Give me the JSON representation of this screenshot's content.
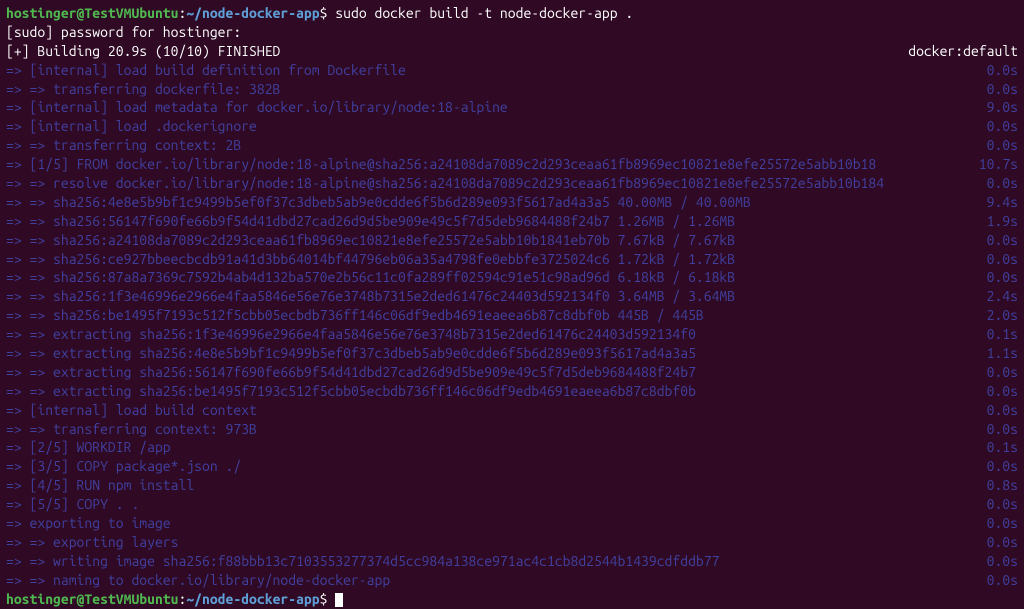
{
  "prompt1": {
    "user": "hostinger@TestVMUbuntu",
    "sep": ":",
    "path": "~/node-docker-app",
    "dollar": "$ ",
    "command": "sudo docker build -t node-docker-app ."
  },
  "sudo_prompt": "[sudo] password for hostinger:",
  "build_status": {
    "left": "[+] Building 20.9s (10/10) FINISHED",
    "right": "docker:default"
  },
  "lines": [
    {
      "text": "=> [internal] load build definition from Dockerfile",
      "time": "0.0s"
    },
    {
      "text": "=> => transferring dockerfile: 382B",
      "time": "0.0s"
    },
    {
      "text": "=> [internal] load metadata for docker.io/library/node:18-alpine",
      "time": "9.0s"
    },
    {
      "text": "=> [internal] load .dockerignore",
      "time": "0.0s"
    },
    {
      "text": "=> => transferring context: 2B",
      "time": "0.0s"
    },
    {
      "text": "=> [1/5] FROM docker.io/library/node:18-alpine@sha256:a24108da7089c2d293ceaa61fb8969ec10821e8efe25572e5abb10b18",
      "time": "10.7s"
    },
    {
      "text": "=> => resolve docker.io/library/node:18-alpine@sha256:a24108da7089c2d293ceaa61fb8969ec10821e8efe25572e5abb10b184",
      "time": "0.0s"
    },
    {
      "text": "=> => sha256:4e8e5b9bf1c9499b5ef0f37c3dbeb5ab9e0cdde6f5b6d289e093f5617ad4a3a5 40.00MB / 40.00MB",
      "time": "9.4s"
    },
    {
      "text": "=> => sha256:56147f690fe66b9f54d41dbd27cad26d9d5be909e49c5f7d5deb9684488f24b7 1.26MB / 1.26MB",
      "time": "1.9s"
    },
    {
      "text": "=> => sha256:a24108da7089c2d293ceaa61fb8969ec10821e8efe25572e5abb10b1841eb70b 7.67kB / 7.67kB",
      "time": "0.0s"
    },
    {
      "text": "=> => sha256:ce927bbeecbcdb91a41d3bb64014bf44796eb06a35a4798fe0ebbfe3725024c6 1.72kB / 1.72kB",
      "time": "0.0s"
    },
    {
      "text": "=> => sha256:87a8a7369c7592b4ab4d132ba570e2b56c11c0fa289ff02594c91e51c98ad96d 6.18kB / 6.18kB",
      "time": "0.0s"
    },
    {
      "text": "=> => sha256:1f3e46996e2966e4faa5846e56e76e3748b7315e2ded61476c24403d592134f0 3.64MB / 3.64MB",
      "time": "2.4s"
    },
    {
      "text": "=> => sha256:be1495f7193c512f5cbb05ecbdb736ff146c06df9edb4691eaeea6b87c8dbf0b 445B / 445B",
      "time": "2.0s"
    },
    {
      "text": "=> => extracting sha256:1f3e46996e2966e4faa5846e56e76e3748b7315e2ded61476c24403d592134f0",
      "time": "0.1s"
    },
    {
      "text": "=> => extracting sha256:4e8e5b9bf1c9499b5ef0f37c3dbeb5ab9e0cdde6f5b6d289e093f5617ad4a3a5",
      "time": "1.1s"
    },
    {
      "text": "=> => extracting sha256:56147f690fe66b9f54d41dbd27cad26d9d5be909e49c5f7d5deb9684488f24b7",
      "time": "0.0s"
    },
    {
      "text": "=> => extracting sha256:be1495f7193c512f5cbb05ecbdb736ff146c06df9edb4691eaeea6b87c8dbf0b",
      "time": "0.0s"
    },
    {
      "text": "=> [internal] load build context",
      "time": "0.0s"
    },
    {
      "text": "=> => transferring context: 973B",
      "time": "0.0s"
    },
    {
      "text": "=> [2/5] WORKDIR /app",
      "time": "0.1s"
    },
    {
      "text": "=> [3/5] COPY package*.json ./",
      "time": "0.0s"
    },
    {
      "text": "=> [4/5] RUN npm install",
      "time": "0.8s"
    },
    {
      "text": "=> [5/5] COPY . .",
      "time": "0.0s"
    },
    {
      "text": "=> exporting to image",
      "time": "0.0s"
    },
    {
      "text": "=> => exporting layers",
      "time": "0.0s"
    },
    {
      "text": "=> => writing image sha256:f88bbb13c7103553277374d5cc984a138ce971ac4c1cb8d2544b1439cdfddb77",
      "time": "0.0s"
    },
    {
      "text": "=> => naming to docker.io/library/node-docker-app",
      "time": "0.0s"
    }
  ],
  "prompt2": {
    "user": "hostinger@TestVMUbuntu",
    "sep": ":",
    "path": "~/node-docker-app",
    "dollar": "$ "
  }
}
